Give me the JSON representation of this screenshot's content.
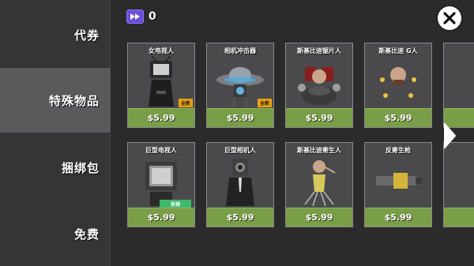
{
  "sidebar": {
    "items": [
      {
        "label": "代券",
        "active": false
      },
      {
        "label": "特殊物品",
        "active": true
      },
      {
        "label": "捆绑包",
        "active": false
      },
      {
        "label": "免费",
        "active": false
      }
    ]
  },
  "currency": {
    "icon": "fast-forward-ticket-icon",
    "value": "0"
  },
  "close": {
    "icon": "close-icon"
  },
  "products": [
    {
      "name": "女电视人",
      "price": "$5.99",
      "badge": "全新",
      "art": "tv-woman"
    },
    {
      "name": "相机冲击器",
      "price": "$5.99",
      "badge": "全新",
      "art": "camera-ufo"
    },
    {
      "name": "斯基比迪锯片人",
      "price": "$5.99",
      "badge": "",
      "art": "saw-toilet"
    },
    {
      "name": "斯基比迪 G人",
      "price": "$5.99",
      "badge": "",
      "art": "g-toilet"
    },
    {
      "name": "巨型电视人",
      "price": "$5.99",
      "badge": "热销",
      "art": "titan-tv"
    },
    {
      "name": "巨型相机人",
      "price": "$5.99",
      "badge": "",
      "art": "titan-camera"
    },
    {
      "name": "斯基比迪寄生人",
      "price": "$5.99",
      "badge": "",
      "art": "parasite"
    },
    {
      "name": "反寄生枪",
      "price": "$5.99",
      "badge": "",
      "art": "gun"
    }
  ],
  "colors": {
    "price_bg": "#7a9d48",
    "badge_new": "#e8a416",
    "badge_hot": "#3fb86a",
    "ticket": "#6a4fd6"
  }
}
